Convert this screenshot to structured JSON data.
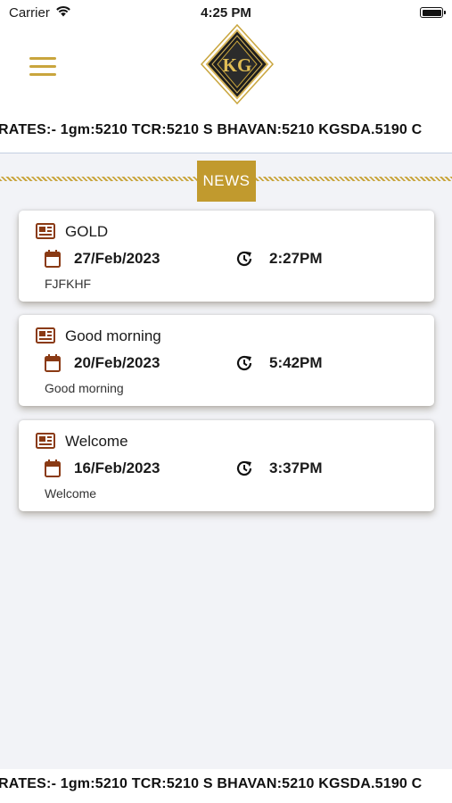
{
  "status_bar": {
    "carrier": "Carrier",
    "time": "4:25 PM"
  },
  "header": {
    "logo_text": "KG",
    "menu_icon": "hamburger-menu-icon"
  },
  "ticker": {
    "top_text": "RATES:- 1gm:5210 TCR:5210 S BHAVAN:5210 KGSDA.5190 C",
    "bottom_text": "RATES:- 1gm:5210 TCR:5210 S BHAVAN:5210 KGSDA.5190 C"
  },
  "news_section": {
    "label": "NEWS"
  },
  "news": [
    {
      "title": "GOLD",
      "date": "27/Feb/2023",
      "time": "2:27PM",
      "description": "FJFKHF"
    },
    {
      "title": "Good morning",
      "date": "20/Feb/2023",
      "time": "5:42PM",
      "description": "Good morning"
    },
    {
      "title": "Welcome",
      "date": "16/Feb/2023",
      "time": "3:37PM",
      "description": "Welcome"
    }
  ],
  "colors": {
    "accent_gold": "#c19a2e",
    "icon_brown": "#8a3a14",
    "background": "#f2f3f7"
  }
}
